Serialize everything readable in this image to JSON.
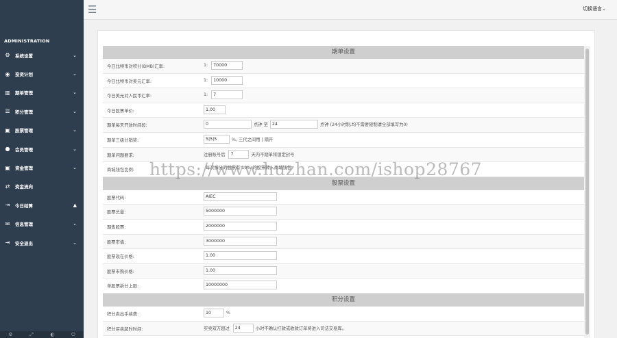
{
  "sidebar": {
    "brand": "ADMINISTRATION",
    "items": [
      {
        "icon": "gear-icon",
        "glyph": "⚙",
        "label": "系统设置",
        "caret": "⌄"
      },
      {
        "icon": "globe-icon",
        "glyph": "◉",
        "label": "投资计划",
        "caret": "⌄"
      },
      {
        "icon": "map-icon",
        "glyph": "▥",
        "label": "期单管理",
        "caret": "⌄"
      },
      {
        "icon": "list-icon",
        "glyph": "☰",
        "label": "积分管理",
        "caret": "⌄"
      },
      {
        "icon": "money-icon",
        "glyph": "▣",
        "label": "股票管理",
        "caret": "⌄"
      },
      {
        "icon": "user-icon",
        "glyph": "●",
        "label": "会员管理",
        "caret": "⌄"
      },
      {
        "icon": "cash-icon",
        "glyph": "▣",
        "label": "资金管理",
        "caret": "⌄"
      },
      {
        "icon": "flow-icon",
        "glyph": "⇄",
        "label": "资金流向",
        "caret": ""
      },
      {
        "icon": "signout-icon",
        "glyph": "⇥",
        "label": "今日结算",
        "caret": "▲"
      },
      {
        "icon": "mail-icon",
        "glyph": "✉",
        "label": "信息管理",
        "caret": "⌄"
      },
      {
        "icon": "exit-icon",
        "glyph": "⇥",
        "label": "安全退出",
        "caret": "⌄"
      }
    ],
    "footer": [
      "⚙",
      "⤢",
      "◐",
      "⏻"
    ]
  },
  "topbar": {
    "menu_icon": "☰",
    "language_label": "切换语言⌄"
  },
  "sections": {
    "order": {
      "title": "期单设置",
      "rows": [
        {
          "label": "今日比特币对积分(BMB)汇率:",
          "pre": "1:",
          "value": "70000"
        },
        {
          "label": "今日比特币对美元汇率:",
          "pre": "1:",
          "value": "10000"
        },
        {
          "label": "今日美元对人民币汇率:",
          "pre": "1:",
          "value": "7"
        },
        {
          "label": "今日股票单价:",
          "value": "1.00"
        },
        {
          "label": "期单每天开放时间段:",
          "value": "0",
          "mid": "点钟 至",
          "value2": "24",
          "post": "点钟 (24小时制,均不需要限制请全部填写为0)"
        },
        {
          "label": "期单三级分销奖:",
          "value": "5|5|5",
          "post": "%, 三代之间用 | 隔开"
        },
        {
          "label": "期单问题要求:",
          "pre": "注册账号后",
          "value": "7",
          "post": "天内不期单将锁定封号"
        },
        {
          "label": "商城钱包比例:",
          "post": "每次拆分的股票有 10% 的股票转入商城钱包"
        }
      ]
    },
    "stock": {
      "title": "股票设置",
      "rows": [
        {
          "label": "股票代码:",
          "value": "AIEC"
        },
        {
          "label": "股票总量:",
          "value": "5000000"
        },
        {
          "label": "期售股票:",
          "value": "2000000"
        },
        {
          "label": "股票市值:",
          "value": "3000000"
        },
        {
          "label": "股票现在价格:",
          "value": "1.00"
        },
        {
          "label": "股票市购价格:",
          "value": "1.00"
        },
        {
          "label": "单股票拆分上限:",
          "value": "10000000"
        }
      ]
    },
    "points": {
      "title": "积分设置",
      "rows": [
        {
          "label": "积分卖出手续费:",
          "value": "10",
          "post": "%"
        },
        {
          "label": "积分买卖超时时间:",
          "pre": "买卖双方超过",
          "value": "24",
          "post": "小时不确认打款或收款订单将进入司法交易库。"
        }
      ]
    }
  },
  "watermark": "https://www.huzhan.com/ishop28767"
}
